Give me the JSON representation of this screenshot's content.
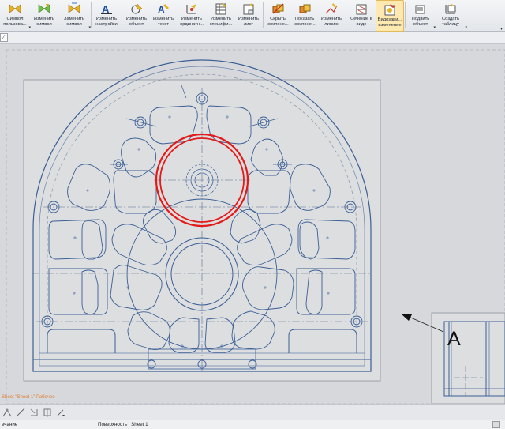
{
  "ribbon": {
    "buttons": [
      {
        "id": "symbol-user",
        "label1": "Символ",
        "label2": "пользова...",
        "icon": "bowtie-gold-icon",
        "dd": true
      },
      {
        "id": "change-symbol",
        "label1": "Изменить",
        "label2": "символ",
        "icon": "bowtie-green-icon",
        "dd": false
      },
      {
        "id": "replace-symbol",
        "label1": "Заменить",
        "label2": "символ",
        "icon": "bowtie-swap-icon",
        "dd": true
      },
      {
        "id": "change-settings",
        "label1": "Изменить",
        "label2": "настройки",
        "icon": "text-a-icon",
        "dd": false
      },
      {
        "id": "change-object",
        "label1": "Изменить",
        "label2": "объект",
        "icon": "pencil-object-icon",
        "dd": false
      },
      {
        "id": "change-text",
        "label1": "Изменить",
        "label2": "текст",
        "icon": "text-edit-icon",
        "dd": false
      },
      {
        "id": "change-ordinate",
        "label1": "Изменить",
        "label2": "ординатн...",
        "icon": "ordinate-icon",
        "dd": false
      },
      {
        "id": "change-spec",
        "label1": "Изменить",
        "label2": "специфи...",
        "icon": "spec-table-icon",
        "dd": false
      },
      {
        "id": "change-sheet",
        "label1": "Изменить",
        "label2": "лист",
        "icon": "sheet-icon",
        "dd": false
      },
      {
        "id": "hide-component",
        "label1": "Скрыть",
        "label2": "компоне...",
        "icon": "hide-component-icon",
        "dd": false
      },
      {
        "id": "show-component",
        "label1": "Показать",
        "label2": "компоне...",
        "icon": "show-component-icon",
        "dd": false
      },
      {
        "id": "change-line",
        "label1": "Изменить",
        "label2": "линию",
        "icon": "line-edit-icon",
        "dd": false
      },
      {
        "id": "section-in-view",
        "label1": "Сечение в",
        "label2": "виде",
        "icon": "section-view-icon",
        "dd": false
      },
      {
        "id": "view-modify",
        "label1": "Видозави...",
        "label2": "изменение",
        "icon": "view-modify-icon",
        "dd": false,
        "active": true
      },
      {
        "id": "align-object",
        "label1": "Подвить",
        "label2": "объект",
        "icon": "align-object-icon",
        "dd": true
      },
      {
        "id": "create-table",
        "label1": "Создать",
        "label2": "таблицу",
        "icon": "create-table-icon",
        "dd": true
      }
    ]
  },
  "drawing": {
    "arrow_label": "A",
    "sheet_label": "Sheet \"Sheet 1\" Рабочее"
  },
  "status": {
    "left": "ечание",
    "middle": "Поверхность : Sheet 1"
  }
}
